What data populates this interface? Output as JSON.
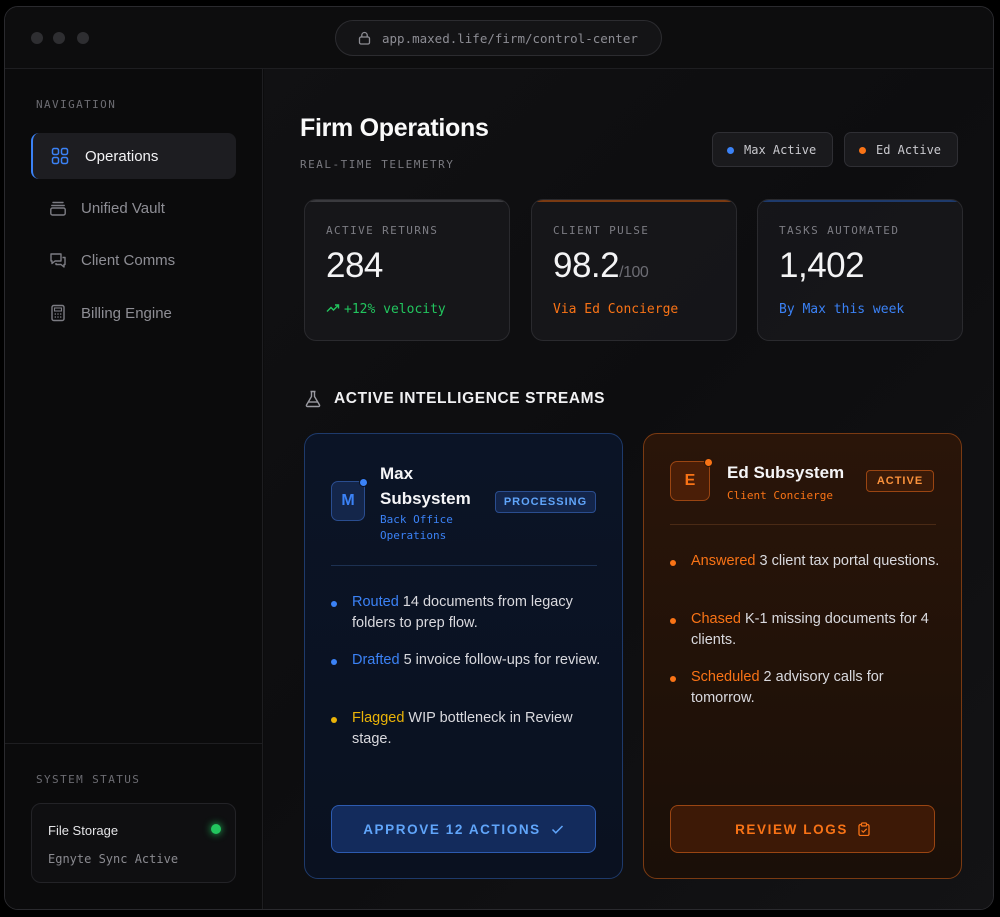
{
  "browser": {
    "url": "app.maxed.life/firm/control-center"
  },
  "sidebar": {
    "heading": "NAVIGATION",
    "items": [
      {
        "label": "Operations",
        "icon": "grid-icon",
        "active": true
      },
      {
        "label": "Unified Vault",
        "icon": "archive-icon",
        "active": false
      },
      {
        "label": "Client Comms",
        "icon": "chat-icon",
        "active": false
      },
      {
        "label": "Billing Engine",
        "icon": "calculator-icon",
        "active": false
      }
    ],
    "status": {
      "heading": "SYSTEM STATUS",
      "title": "File Storage",
      "detail": "Egnyte Sync Active",
      "color": "#22c55e"
    }
  },
  "header": {
    "title": "Firm Operations",
    "subtitle": "REAL-TIME TELEMETRY",
    "pills": [
      {
        "label": "Max Active",
        "color": "#3b82f6"
      },
      {
        "label": "Ed Active",
        "color": "#f97316"
      }
    ]
  },
  "stats": [
    {
      "label": "ACTIVE RETURNS",
      "value": "284",
      "suffix": "",
      "sub": "+12% velocity",
      "sub_color": "#22c55e",
      "accent": "#3a3a3e"
    },
    {
      "label": "CLIENT PULSE",
      "value": "98.2",
      "suffix": "/100",
      "sub": "Via Ed Concierge",
      "sub_color": "#f97316",
      "accent": "#7a3a12"
    },
    {
      "label": "TASKS AUTOMATED",
      "value": "1,402",
      "suffix": "",
      "sub": "By Max this week",
      "sub_color": "#3b82f6",
      "accent": "#1e3a6b"
    }
  ],
  "streams": {
    "title": "ACTIVE INTELLIGENCE STREAMS",
    "max": {
      "initial": "M",
      "name_line1": "Max",
      "name_line2": "Subsystem",
      "role_line1": "Back Office",
      "role_line2": "Operations",
      "badge": "PROCESSING",
      "bullets": [
        {
          "keyword": "Routed",
          "text": " 14 documents from legacy folders to prep flow.",
          "color": "#3b82f6"
        },
        {
          "keyword": "Drafted",
          "text": " 5 invoice follow-ups for review.",
          "color": "#3b82f6"
        },
        {
          "keyword": "Flagged",
          "text": " WIP bottleneck in Review stage.",
          "color": "#eab308"
        }
      ],
      "action": "APPROVE 12 ACTIONS"
    },
    "ed": {
      "initial": "E",
      "name": "Ed Subsystem",
      "role": "Client Concierge",
      "badge": "ACTIVE",
      "bullets": [
        {
          "keyword": "Answered",
          "text": " 3 client tax portal questions.",
          "color": "#f97316"
        },
        {
          "keyword": "Chased",
          "text": " K-1 missing documents for 4 clients.",
          "color": "#f97316"
        },
        {
          "keyword": "Scheduled",
          "text": " 2 advisory calls for tomorrow.",
          "color": "#f97316"
        }
      ],
      "action": "REVIEW LOGS"
    }
  }
}
